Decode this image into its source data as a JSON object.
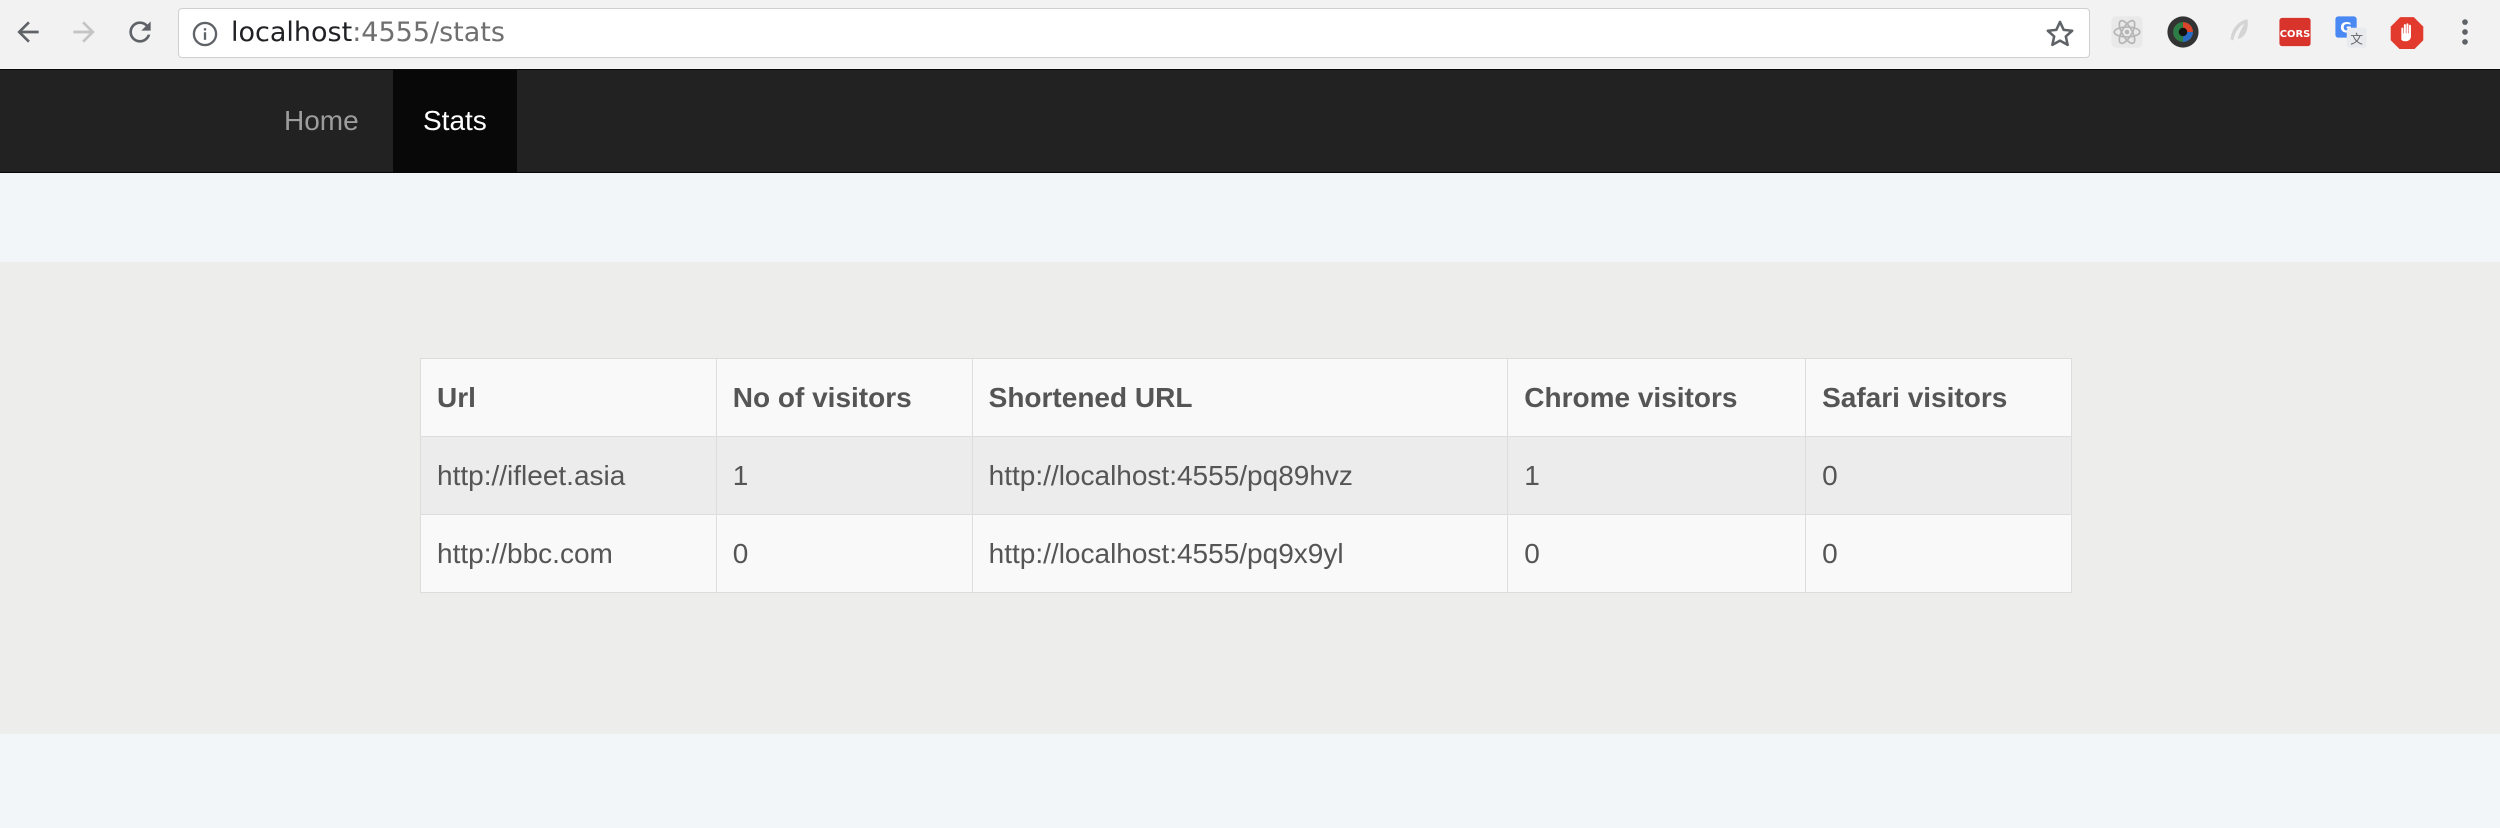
{
  "browser": {
    "url_host": "localhost",
    "url_rest": ":4555/stats"
  },
  "nav": {
    "items": [
      {
        "label": "Home",
        "active": false
      },
      {
        "label": "Stats",
        "active": true
      }
    ]
  },
  "table": {
    "headers": [
      "Url",
      "No of visitors",
      "Shortened URL",
      "Chrome visitors",
      "Safari visitors"
    ],
    "rows": [
      [
        "http://ifleet.asia",
        "1",
        "http://localhost:4555/pq89hvz",
        "1",
        "0"
      ],
      [
        "http://bbc.com",
        "0",
        "http://localhost:4555/pq9x9yl",
        "0",
        "0"
      ]
    ]
  },
  "colors": {
    "navbar_bg": "#222222",
    "navbar_active_bg": "#080808",
    "page_bg": "#f3f6f9",
    "content_bg": "#ededec",
    "table_text": "#555555"
  },
  "icons": {
    "extensions": [
      "react-devtools-icon",
      "color-picker-icon",
      "feather-icon",
      "cors-icon",
      "google-translate-icon",
      "adblock-icon"
    ]
  }
}
